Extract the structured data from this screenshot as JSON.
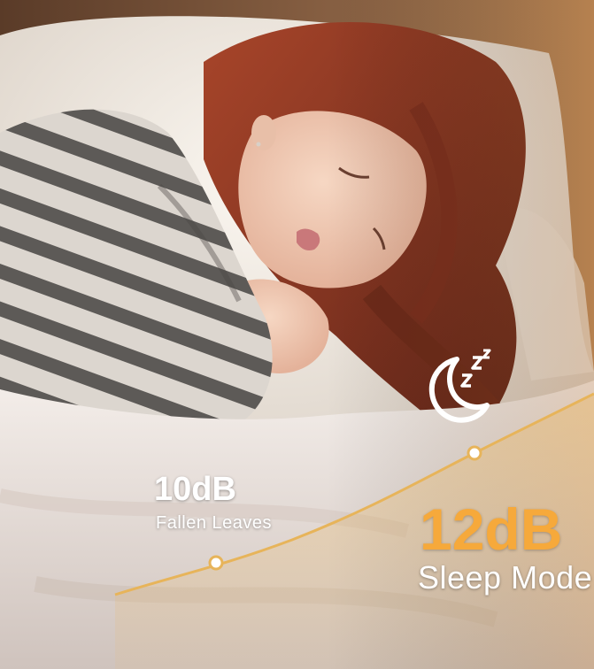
{
  "markers": [
    {
      "value": "10dB",
      "name": "Fallen Leaves"
    },
    {
      "value": "12dB",
      "name": "Sleep Mode"
    }
  ],
  "icon": "moon-zzz-icon",
  "colors": {
    "accent": "#f6a93b",
    "curve": "#e7b45a",
    "label_text": "#ffffff"
  }
}
